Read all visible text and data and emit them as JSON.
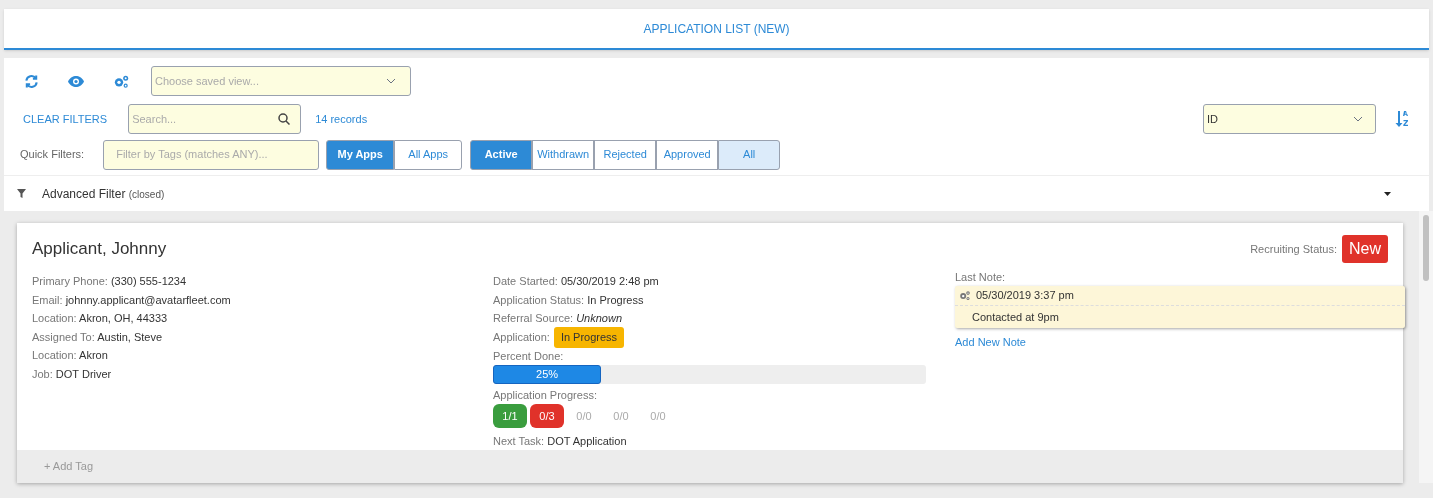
{
  "header": {
    "title": "APPLICATION LIST (NEW)"
  },
  "toolbar": {
    "saved_view": {
      "placeholder": "Choose saved view..."
    }
  },
  "filters": {
    "clear": "CLEAR FILTERS",
    "search": {
      "placeholder": "Search..."
    },
    "records": "14 records",
    "sort_field": {
      "value": "ID"
    },
    "quick_label": "Quick Filters:",
    "tags": {
      "placeholder": "Filter by Tags (matches ANY)..."
    },
    "owner_tabs": [
      {
        "label": "My Apps",
        "selected": true
      },
      {
        "label": "All Apps",
        "selected": false
      }
    ],
    "status_tabs": [
      {
        "label": "Active",
        "selected": true
      },
      {
        "label": "Withdrawn",
        "selected": false
      },
      {
        "label": "Rejected",
        "selected": false
      },
      {
        "label": "Approved",
        "selected": false
      },
      {
        "label": "All",
        "selected": false,
        "hovered": true
      }
    ]
  },
  "advanced_filter": {
    "label": "Advanced Filter",
    "state": "(closed)",
    "expanded": false
  },
  "card": {
    "name": "Applicant, Johnny",
    "recruiting_label": "Recruiting Status:",
    "recruiting_status": "New",
    "left": [
      {
        "label": "Primary Phone:",
        "value": "(330) 555-1234"
      },
      {
        "label": "Email:",
        "value": "johnny.applicant@avatarfleet.com"
      },
      {
        "label": "Location:",
        "value": "Akron, OH, 44333"
      },
      {
        "label": "Assigned To:",
        "value": "Austin, Steve"
      },
      {
        "label": "Location:",
        "value": "Akron"
      },
      {
        "label": "Job:",
        "value": "DOT Driver"
      }
    ],
    "middle": [
      {
        "kind": "text",
        "label": "Date Started:",
        "value": "05/30/2019 2:48 pm"
      },
      {
        "kind": "text",
        "label": "Application Status:",
        "value": "In Progress"
      },
      {
        "kind": "text",
        "label": "Referral Source:",
        "value": "*Unknown*"
      },
      {
        "kind": "badge",
        "label": "Application:",
        "value": "In Progress"
      }
    ],
    "percent_label": "Percent Done:",
    "percent": {
      "level": 0.25,
      "reading": "25%"
    },
    "progress_label": "Application Progress:",
    "steps": [
      {
        "text": "1/1",
        "kind": "done"
      },
      {
        "text": "0/3",
        "kind": "failed"
      },
      {
        "text": "0/0",
        "kind": "pending"
      },
      {
        "text": "0/0",
        "kind": "pending"
      },
      {
        "text": "0/0",
        "kind": "pending"
      }
    ],
    "next_task": {
      "label": "Next Task:",
      "value": "DOT Application"
    },
    "last_note_label": "Last Note:",
    "note": {
      "time": "05/30/2019 3:37 pm",
      "text": "Contacted at 9pm"
    },
    "add_note": "Add New Note",
    "add_tag": "+ Add Tag"
  }
}
